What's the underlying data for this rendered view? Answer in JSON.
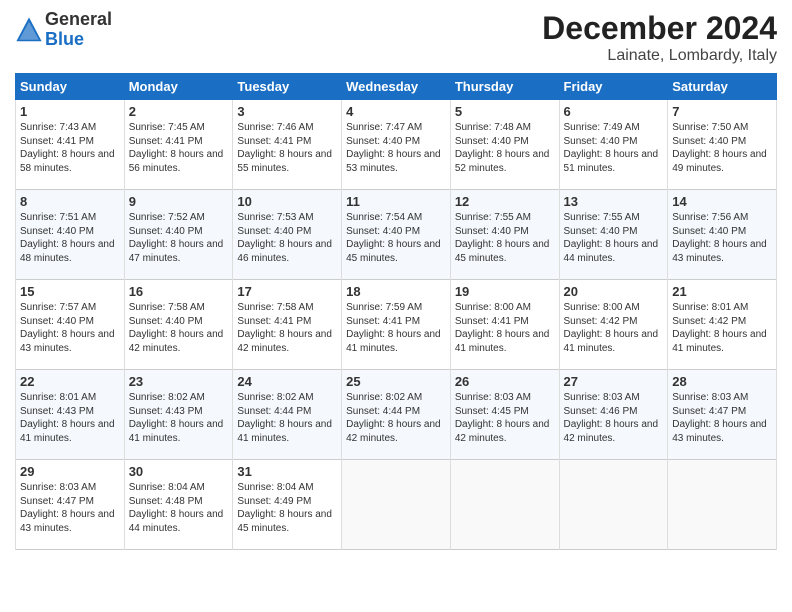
{
  "header": {
    "logo_general": "General",
    "logo_blue": "Blue",
    "month_title": "December 2024",
    "location": "Lainate, Lombardy, Italy"
  },
  "columns": [
    "Sunday",
    "Monday",
    "Tuesday",
    "Wednesday",
    "Thursday",
    "Friday",
    "Saturday"
  ],
  "weeks": [
    [
      {
        "day": "1",
        "sunrise": "7:43 AM",
        "sunset": "4:41 PM",
        "daylight": "8 hours and 58 minutes."
      },
      {
        "day": "2",
        "sunrise": "7:45 AM",
        "sunset": "4:41 PM",
        "daylight": "8 hours and 56 minutes."
      },
      {
        "day": "3",
        "sunrise": "7:46 AM",
        "sunset": "4:41 PM",
        "daylight": "8 hours and 55 minutes."
      },
      {
        "day": "4",
        "sunrise": "7:47 AM",
        "sunset": "4:40 PM",
        "daylight": "8 hours and 53 minutes."
      },
      {
        "day": "5",
        "sunrise": "7:48 AM",
        "sunset": "4:40 PM",
        "daylight": "8 hours and 52 minutes."
      },
      {
        "day": "6",
        "sunrise": "7:49 AM",
        "sunset": "4:40 PM",
        "daylight": "8 hours and 51 minutes."
      },
      {
        "day": "7",
        "sunrise": "7:50 AM",
        "sunset": "4:40 PM",
        "daylight": "8 hours and 49 minutes."
      }
    ],
    [
      {
        "day": "8",
        "sunrise": "7:51 AM",
        "sunset": "4:40 PM",
        "daylight": "8 hours and 48 minutes."
      },
      {
        "day": "9",
        "sunrise": "7:52 AM",
        "sunset": "4:40 PM",
        "daylight": "8 hours and 47 minutes."
      },
      {
        "day": "10",
        "sunrise": "7:53 AM",
        "sunset": "4:40 PM",
        "daylight": "8 hours and 46 minutes."
      },
      {
        "day": "11",
        "sunrise": "7:54 AM",
        "sunset": "4:40 PM",
        "daylight": "8 hours and 45 minutes."
      },
      {
        "day": "12",
        "sunrise": "7:55 AM",
        "sunset": "4:40 PM",
        "daylight": "8 hours and 45 minutes."
      },
      {
        "day": "13",
        "sunrise": "7:55 AM",
        "sunset": "4:40 PM",
        "daylight": "8 hours and 44 minutes."
      },
      {
        "day": "14",
        "sunrise": "7:56 AM",
        "sunset": "4:40 PM",
        "daylight": "8 hours and 43 minutes."
      }
    ],
    [
      {
        "day": "15",
        "sunrise": "7:57 AM",
        "sunset": "4:40 PM",
        "daylight": "8 hours and 43 minutes."
      },
      {
        "day": "16",
        "sunrise": "7:58 AM",
        "sunset": "4:40 PM",
        "daylight": "8 hours and 42 minutes."
      },
      {
        "day": "17",
        "sunrise": "7:58 AM",
        "sunset": "4:41 PM",
        "daylight": "8 hours and 42 minutes."
      },
      {
        "day": "18",
        "sunrise": "7:59 AM",
        "sunset": "4:41 PM",
        "daylight": "8 hours and 41 minutes."
      },
      {
        "day": "19",
        "sunrise": "8:00 AM",
        "sunset": "4:41 PM",
        "daylight": "8 hours and 41 minutes."
      },
      {
        "day": "20",
        "sunrise": "8:00 AM",
        "sunset": "4:42 PM",
        "daylight": "8 hours and 41 minutes."
      },
      {
        "day": "21",
        "sunrise": "8:01 AM",
        "sunset": "4:42 PM",
        "daylight": "8 hours and 41 minutes."
      }
    ],
    [
      {
        "day": "22",
        "sunrise": "8:01 AM",
        "sunset": "4:43 PM",
        "daylight": "8 hours and 41 minutes."
      },
      {
        "day": "23",
        "sunrise": "8:02 AM",
        "sunset": "4:43 PM",
        "daylight": "8 hours and 41 minutes."
      },
      {
        "day": "24",
        "sunrise": "8:02 AM",
        "sunset": "4:44 PM",
        "daylight": "8 hours and 41 minutes."
      },
      {
        "day": "25",
        "sunrise": "8:02 AM",
        "sunset": "4:44 PM",
        "daylight": "8 hours and 42 minutes."
      },
      {
        "day": "26",
        "sunrise": "8:03 AM",
        "sunset": "4:45 PM",
        "daylight": "8 hours and 42 minutes."
      },
      {
        "day": "27",
        "sunrise": "8:03 AM",
        "sunset": "4:46 PM",
        "daylight": "8 hours and 42 minutes."
      },
      {
        "day": "28",
        "sunrise": "8:03 AM",
        "sunset": "4:47 PM",
        "daylight": "8 hours and 43 minutes."
      }
    ],
    [
      {
        "day": "29",
        "sunrise": "8:03 AM",
        "sunset": "4:47 PM",
        "daylight": "8 hours and 43 minutes."
      },
      {
        "day": "30",
        "sunrise": "8:04 AM",
        "sunset": "4:48 PM",
        "daylight": "8 hours and 44 minutes."
      },
      {
        "day": "31",
        "sunrise": "8:04 AM",
        "sunset": "4:49 PM",
        "daylight": "8 hours and 45 minutes."
      },
      null,
      null,
      null,
      null
    ]
  ],
  "labels": {
    "sunrise": "Sunrise:",
    "sunset": "Sunset:",
    "daylight": "Daylight:"
  }
}
